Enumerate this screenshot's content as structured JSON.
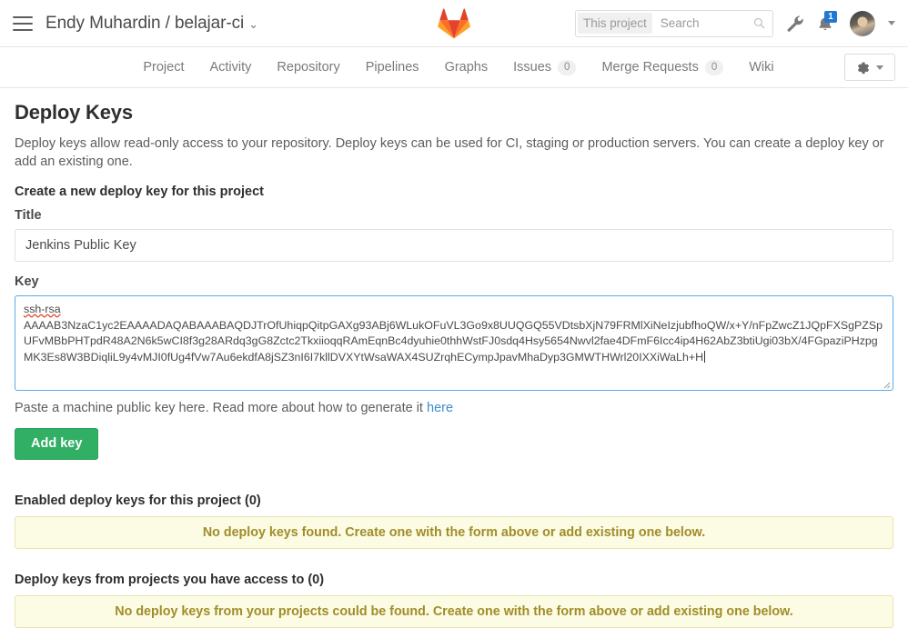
{
  "navbar": {
    "menu_icon": "hamburger-menu-icon",
    "breadcrumb": "Endy Muhardin / belajar-ci",
    "breadcrumb_caret": "⌄",
    "logo": "gitlab-logo",
    "search": {
      "scope": "This project",
      "placeholder": "Search",
      "icon": "search-icon"
    },
    "wrench_icon": "wrench-icon",
    "notification_icon": "bell-icon",
    "notification_count": "1",
    "avatar": "user-avatar",
    "avatar_caret": "chevron-down-icon"
  },
  "subnav": {
    "tabs": [
      {
        "label": "Project",
        "count": null
      },
      {
        "label": "Activity",
        "count": null
      },
      {
        "label": "Repository",
        "count": null
      },
      {
        "label": "Pipelines",
        "count": null
      },
      {
        "label": "Graphs",
        "count": null
      },
      {
        "label": "Issues",
        "count": "0"
      },
      {
        "label": "Merge Requests",
        "count": "0"
      },
      {
        "label": "Wiki",
        "count": null
      }
    ],
    "settings_icon": "gear-icon",
    "settings_caret": "chevron-down-icon"
  },
  "page": {
    "title": "Deploy Keys",
    "description": "Deploy keys allow read-only access to your repository. Deploy keys can be used for CI, staging or production servers. You can create a deploy key or add an existing one.",
    "form_heading": "Create a new deploy key for this project"
  },
  "form": {
    "title_label": "Title",
    "title_value": "Jenkins Public Key",
    "title_placeholder": "",
    "key_label": "Key",
    "key_prefix": "ssh-rsa",
    "key_body": "\nAAAAB3NzaC1yc2EAAAADAQABAAABAQDJTrOfUhiqpQitpGAXg93ABj6WLukOFuVL3Go9x8UUQGQ55VDtsbXjN79FRMlXiNeIzjubfhoQW/x+Y/nFpZwcZ1JQpFXSgPZSpUFvMBbPHTpdR48A2N6k5wCI8f3g28ARdq3gG8Zctc2TkxiioqqRAmEqnBc4dyuhie0thhWstFJ0sdq4Hsy5654Nwvl2fae4DFmF6Icc4ip4H62AbZ3btiUgi03bX/4FGpaziPHzpgMK3Es8W3BDiqliL9y4vMJI0fUg4fVw7Au6ekdfA8jSZ3nI6I7kllDVXYtWsaWAX4SUZrqhECympJpavMhaDyp3GMWTHWrl20IXXiWaLh+H",
    "help_text": "Paste a machine public key here. Read more about how to generate it ",
    "help_link": "here",
    "submit_label": "Add key",
    "resize_handle": "textarea-resize-handle"
  },
  "sections": [
    {
      "title": "Enabled deploy keys for this project (0)",
      "empty_message": "No deploy keys found. Create one with the form above or add existing one below."
    },
    {
      "title": "Deploy keys from projects you have access to (0)",
      "empty_message": "No deploy keys from your projects could be found. Create one with the form above or add existing one below."
    }
  ],
  "colors": {
    "accent_green": "#31af64",
    "link_blue": "#3a8cd0",
    "focus_blue": "#5aaaea",
    "warn_bg": "#fcfbe4",
    "warn_text": "#a08d29",
    "badge_blue": "#1f78d1"
  }
}
